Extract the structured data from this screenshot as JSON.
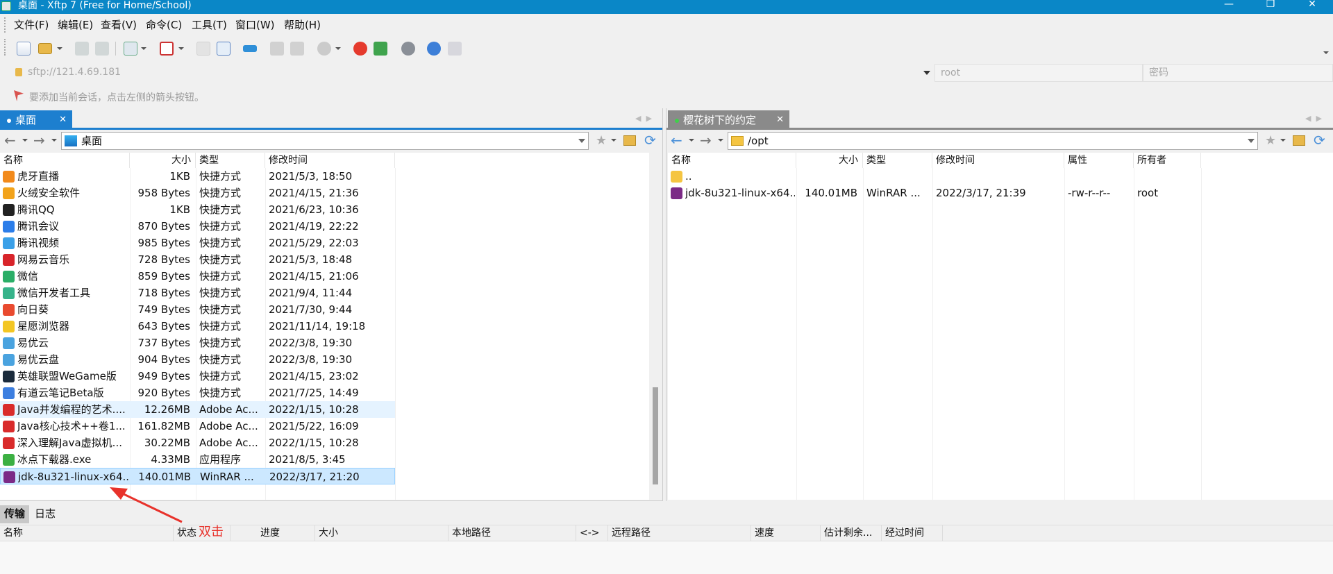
{
  "window": {
    "title": "桌面 - Xftp 7 (Free for Home/School)"
  },
  "menu": [
    "文件(F)",
    "编辑(E)",
    "查看(V)",
    "命令(C)",
    "工具(T)",
    "窗口(W)",
    "帮助(H)"
  ],
  "address": {
    "url": "sftp://121.4.69.181",
    "user": "root",
    "password_placeholder": "密码"
  },
  "hint": "要添加当前会话，点击左侧的箭头按钮。",
  "left": {
    "tab": "桌面",
    "path": "桌面",
    "columns": [
      "名称",
      "大小",
      "类型",
      "修改时间"
    ],
    "files": [
      {
        "name": "虎牙直播",
        "size": "1KB",
        "type": "快捷方式",
        "modified": "2021/5/3, 18:50",
        "icon_color": "#f28a1b"
      },
      {
        "name": "火绒安全软件",
        "size": "958 Bytes",
        "type": "快捷方式",
        "modified": "2021/4/15, 21:36",
        "icon_color": "#f2a31b"
      },
      {
        "name": "腾讯QQ",
        "size": "1KB",
        "type": "快捷方式",
        "modified": "2021/6/23, 10:36",
        "icon_color": "#222222"
      },
      {
        "name": "腾讯会议",
        "size": "870 Bytes",
        "type": "快捷方式",
        "modified": "2021/4/19, 22:22",
        "icon_color": "#2b7de9"
      },
      {
        "name": "腾讯视频",
        "size": "985 Bytes",
        "type": "快捷方式",
        "modified": "2021/5/29, 22:03",
        "icon_color": "#3aa0e8"
      },
      {
        "name": "网易云音乐",
        "size": "728 Bytes",
        "type": "快捷方式",
        "modified": "2021/5/3, 18:48",
        "icon_color": "#d8242a"
      },
      {
        "name": "微信",
        "size": "859 Bytes",
        "type": "快捷方式",
        "modified": "2021/4/15, 21:06",
        "icon_color": "#2aae67"
      },
      {
        "name": "微信开发者工具",
        "size": "718 Bytes",
        "type": "快捷方式",
        "modified": "2021/9/4, 11:44",
        "icon_color": "#36b38a"
      },
      {
        "name": "向日葵",
        "size": "749 Bytes",
        "type": "快捷方式",
        "modified": "2021/7/30, 9:44",
        "icon_color": "#e94a2f"
      },
      {
        "name": "星愿浏览器",
        "size": "643 Bytes",
        "type": "快捷方式",
        "modified": "2021/11/14, 19:18",
        "icon_color": "#f3c623"
      },
      {
        "name": "易优云",
        "size": "737 Bytes",
        "type": "快捷方式",
        "modified": "2022/3/8, 19:30",
        "icon_color": "#4aa3df"
      },
      {
        "name": "易优云盘",
        "size": "904 Bytes",
        "type": "快捷方式",
        "modified": "2022/3/8, 19:30",
        "icon_color": "#4aa3df"
      },
      {
        "name": "英雄联盟WeGame版",
        "size": "949 Bytes",
        "type": "快捷方式",
        "modified": "2021/4/15, 23:02",
        "icon_color": "#1b2b3c"
      },
      {
        "name": "有道云笔记Beta版",
        "size": "920 Bytes",
        "type": "快捷方式",
        "modified": "2021/7/25, 14:49",
        "icon_color": "#3d7fe0"
      },
      {
        "name": "Java并发编程的艺术....",
        "size": "12.26MB",
        "type": "Adobe Ac...",
        "modified": "2022/1/15, 10:28",
        "icon_color": "#d92b2b"
      },
      {
        "name": "Java核心技术++卷1...",
        "size": "161.82MB",
        "type": "Adobe Ac...",
        "modified": "2021/5/22, 16:09",
        "icon_color": "#d92b2b"
      },
      {
        "name": "深入理解Java虚拟机...",
        "size": "30.22MB",
        "type": "Adobe Ac...",
        "modified": "2022/1/15, 10:28",
        "icon_color": "#d92b2b"
      },
      {
        "name": "冰点下载器.exe",
        "size": "4.33MB",
        "type": "应用程序",
        "modified": "2021/8/5, 3:45",
        "icon_color": "#3cb043"
      },
      {
        "name": "jdk-8u321-linux-x64...",
        "size": "140.01MB",
        "type": "WinRAR ...",
        "modified": "2022/3/17, 21:20",
        "icon_color": "#7b2a86"
      }
    ]
  },
  "right": {
    "tab": "樱花树下的约定",
    "path": "/opt",
    "columns": [
      "名称",
      "大小",
      "类型",
      "修改时间",
      "属性",
      "所有者"
    ],
    "files": [
      {
        "name": "..",
        "size": "",
        "type": "",
        "modified": "",
        "attr": "",
        "owner": "",
        "icon_color": "#f5c542"
      },
      {
        "name": "jdk-8u321-linux-x64...",
        "size": "140.01MB",
        "type": "WinRAR ...",
        "modified": "2022/3/17, 21:39",
        "attr": "-rw-r--r--",
        "owner": "root",
        "icon_color": "#7b2a86"
      }
    ]
  },
  "bottom": {
    "tabs": [
      "传输",
      "日志"
    ],
    "columns": [
      "名称",
      "状态",
      "进度",
      "大小",
      "本地路径",
      "<->",
      "远程路径",
      "速度",
      "估计剩余...",
      "经过时间"
    ]
  },
  "annotation": "双击",
  "colors": {
    "accent": "#0a87c7",
    "selected": "#cce8ff",
    "arrow": "#e8322b"
  }
}
